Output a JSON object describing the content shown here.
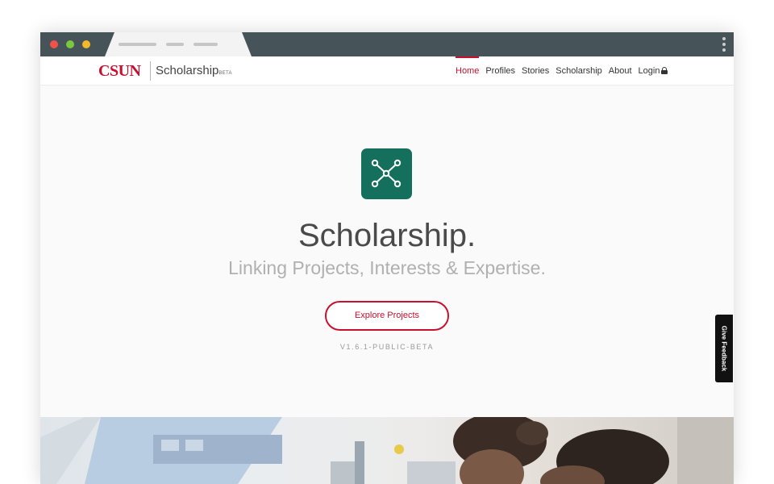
{
  "window": {
    "dots": [
      "close",
      "minimize",
      "zoom"
    ]
  },
  "header": {
    "logo": "CSUN",
    "brand": "Scholarship",
    "brand_badge": "BETA"
  },
  "nav": {
    "items": [
      {
        "label": "Home",
        "active": true
      },
      {
        "label": "Profiles",
        "active": false
      },
      {
        "label": "Stories",
        "active": false
      },
      {
        "label": "Scholarship",
        "active": false
      },
      {
        "label": "About",
        "active": false
      },
      {
        "label": "Login",
        "active": false,
        "icon": "lock-icon"
      }
    ]
  },
  "hero": {
    "icon": "network-icon",
    "title": "Scholarship.",
    "subtitle": "Linking Projects, Interests & Expertise.",
    "button": "Explore Projects",
    "version": "V1.6.1-PUBLIC-BETA"
  },
  "feedback": {
    "label": "Give Feedback"
  },
  "colors": {
    "accent": "#c8102e",
    "icon_bg": "#14705c",
    "chrome": "#465358"
  }
}
